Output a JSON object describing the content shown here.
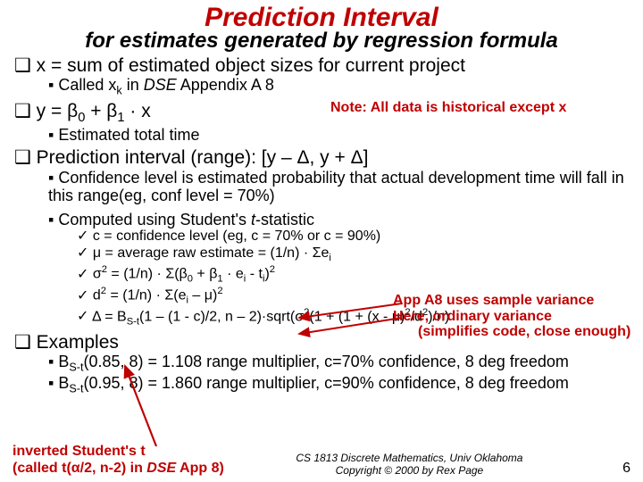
{
  "title": "Prediction Interval",
  "subtitle": "for estimates generated by regression formula",
  "b1": "x = sum of estimated object sizes for current project",
  "b1a_pre": "Called x",
  "b1a_sub": "k",
  "b1a_post": " in ",
  "b1a_it": "DSE",
  "b1a_end": " Appendix A 8",
  "note1": "Note: All data is historical except x",
  "b2_pre": "y = β",
  "b2_s0": "0",
  "b2_mid": " + β",
  "b2_s1": "1",
  "b2_post": " · x",
  "b2a": "Estimated total time",
  "b3": "Prediction interval (range): [y – Δ, y + Δ]",
  "b3a": "Confidence level is estimated probability that actual development time will fall in this range(eg, conf level = 70%)",
  "b3b_pre": "Computed using Student's ",
  "b3b_it": "t",
  "b3b_post": "-statistic",
  "c1": "c = confidence level (eg, c = 70%   or   c = 90%)",
  "c2_pre": "μ = average raw estimate = (1/n) · Σe",
  "c2_sub": "i",
  "c3_pre": "σ",
  "c3_sup": "2",
  "c3_mid": " = (1/n) · Σ(β",
  "c3_s0": "0",
  "c3_m2": " + β",
  "c3_s1": "1",
  "c3_m3": " · e",
  "c3_si": "i",
  "c3_m4": "  - t",
  "c3_si2": "i",
  "c3_end": ")",
  "c3_p2": "2",
  "c4_pre": "d",
  "c4_p2": "2",
  "c4_mid": " = (1/n) · Σ(e",
  "c4_si": "i",
  "c4_m2": " – μ)",
  "c4_p2b": "2",
  "c5_pre": "Δ = B",
  "c5_sub": "S-t",
  "c5_mid": "(1 – (1 - c)/2, n – 2)·sqrt(σ",
  "c5_s2": "2",
  "c5_m2": "(1 + (1 + (x - μ)",
  "c5_s2b": "2",
  "c5_m3": "/d",
  "c5_s2c": "2",
  "c5_end": ")/n)",
  "note2a": "App A8 uses sample variance",
  "note2b": "Here, ordinary variance",
  "note2c": "(simplifies code, close enough)",
  "b4": "Examples",
  "e1_pre": "B",
  "e1_sub": "S-t",
  "e1_post": "(0.85, 8) = 1.108   range multiplier, c=70% confidence, 8 deg freedom",
  "e2_pre": "B",
  "e2_sub": "S-t",
  "e2_post": "(0.95, 8) = 1.860   range multiplier, c=90% confidence, 8 deg freedom",
  "foot_left_1": "inverted Student's t",
  "foot_left_2a": "(called t(α/2, n-2) in ",
  "foot_left_2it": "DSE",
  "foot_left_2b": " App 8)",
  "foot_c1": "CS 1813  Discrete Mathematics, Univ Oklahoma",
  "foot_c2": "Copyright © 2000 by Rex Page",
  "page": "6"
}
